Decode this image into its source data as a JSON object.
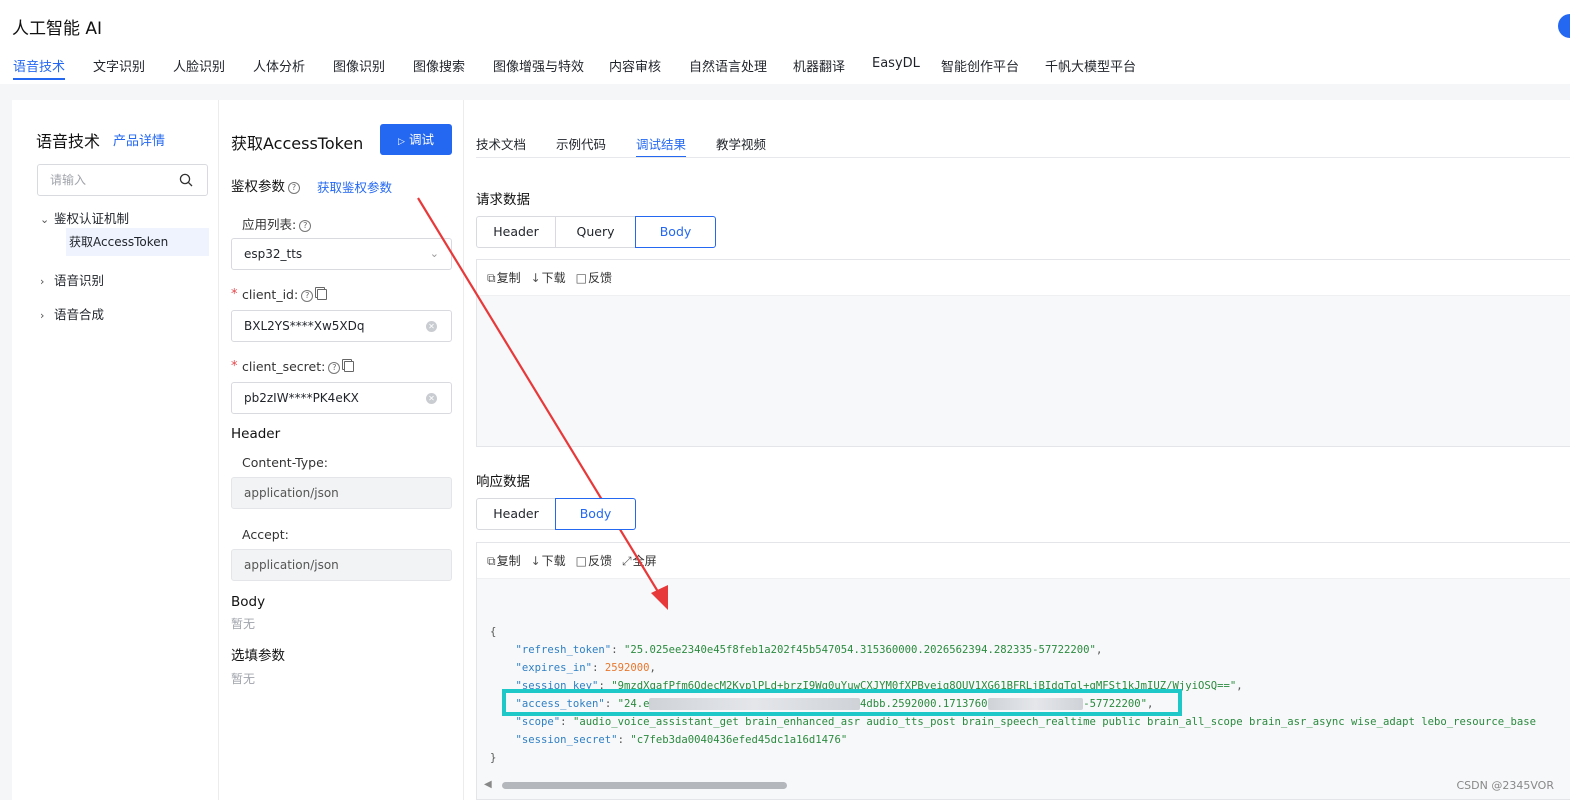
{
  "app": {
    "title": "人工智能 AI"
  },
  "top_tabs": [
    "语音技术",
    "文字识别",
    "人脸识别",
    "人体分析",
    "图像识别",
    "图像搜索",
    "图像增强与特效",
    "内容审核",
    "自然语言处理",
    "机器翻译",
    "EasyDL",
    "智能创作平台",
    "千帆大模型平台"
  ],
  "sidebar": {
    "title": "语音技术",
    "detail_link": "产品详情",
    "search_placeholder": "请输入",
    "tree": {
      "auth_group": "鉴权认证机制",
      "auth_child": "获取AccessToken",
      "asr": "语音识别",
      "tts": "语音合成"
    }
  },
  "form": {
    "title": "获取AccessToken",
    "debug_button": "调试",
    "auth_section": "鉴权参数",
    "auth_link": "获取鉴权参数",
    "app_list_label": "应用列表:",
    "app_list_value": "esp32_tts",
    "client_id_label": "client_id:",
    "client_id_value": "BXL2YS****Xw5XDq",
    "client_secret_label": "client_secret:",
    "client_secret_value": "pb2zIW****PK4eKX",
    "header_section": "Header",
    "content_type_label": "Content-Type:",
    "content_type_value": "application/json",
    "accept_label": "Accept:",
    "accept_value": "application/json",
    "body_section": "Body",
    "body_empty": "暂无",
    "optional_section": "选填参数",
    "optional_empty": "暂无",
    "required_mark": "*"
  },
  "result": {
    "tabs": [
      "技术文档",
      "示例代码",
      "调试结果",
      "教学视频"
    ],
    "request_section": "请求数据",
    "request_segments": [
      "Header",
      "Query",
      "Body"
    ],
    "response_section": "响应数据",
    "response_segments": [
      "Header",
      "Body"
    ],
    "toolbar": {
      "copy": "复制",
      "download": "下载",
      "feedback": "反馈",
      "fullscreen": "全屏"
    },
    "json": {
      "open": "{",
      "close": "}",
      "refresh_token_key": "\"refresh_token\"",
      "refresh_token_val": "\"25.025ee2340e45f8feb1a202f45b547054.315360000.2026562394.282335-57722200\"",
      "expires_in_key": "\"expires_in\"",
      "expires_in_val": "2592000",
      "session_key_key": "\"session_key\"",
      "session_key_val": "\"9mzdXqafPfm6QdecM2KyplPLd+brzI9Wg0uYuwCXJYM0fXPByeig8QUV1XG61BFRLjBIdgTgl+gMFSt1kJmIUZ/WjyiOSQ==\"",
      "access_token_key": "\"access_token\"",
      "access_token_prefix": "\"24.e",
      "access_token_mid1": "4dbb.2592000.1713760",
      "access_token_suffix": "-57722200\"",
      "scope_key": "\"scope\"",
      "scope_val": "\"audio_voice_assistant_get brain_enhanced_asr audio_tts_post brain_speech_realtime public brain_all_scope brain_asr_async wise_adapt lebo_resource_base",
      "session_secret_key": "\"session_secret\"",
      "session_secret_val": "\"c7feb3da0040436efed45dc1a16d1476\""
    }
  },
  "watermark": "CSDN @2345VOR",
  "colors": {
    "accent": "#2468f2",
    "annotation_arrow": "#e8393a",
    "highlight_box": "#1fc8c8"
  },
  "icons": [
    "search-icon",
    "help-icon",
    "copy-icon",
    "clear-icon",
    "chevron-down-icon",
    "chevron-right-icon",
    "play-icon"
  ]
}
